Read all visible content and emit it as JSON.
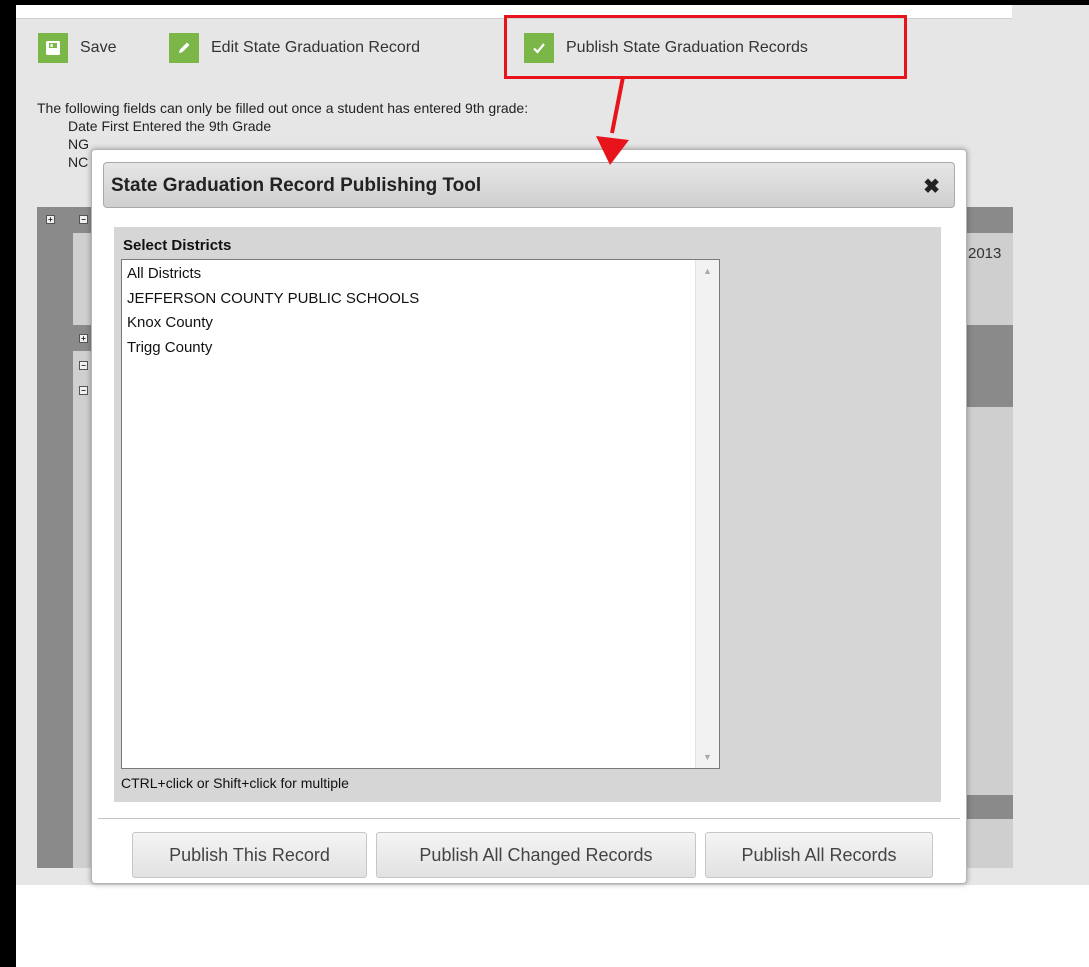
{
  "toolbar": {
    "save_label": "Save",
    "edit_label": "Edit State Graduation Record",
    "publish_label": "Publish State Graduation Records"
  },
  "notice": {
    "intro": "The following fields can only be filled out once a student has entered 9th grade:",
    "items": [
      "Date First Entered the 9th Grade",
      "NG",
      "NC"
    ]
  },
  "background": {
    "year_text": "2013"
  },
  "modal": {
    "title": "State Graduation Record Publishing Tool",
    "districts_label": "Select Districts",
    "districts": [
      "All Districts",
      "JEFFERSON COUNTY PUBLIC SCHOOLS",
      "Knox County",
      "Trigg County"
    ],
    "hint": "CTRL+click or Shift+click for multiple",
    "buttons": {
      "publish_this": "Publish This Record",
      "publish_changed": "Publish All Changed Records",
      "publish_all": "Publish All Records"
    }
  },
  "colors": {
    "accent_green": "#7ab648",
    "highlight_red": "#e8141b",
    "modal_header": "#d8d8d8"
  },
  "icons": {
    "save": "save-icon",
    "edit": "pencil-icon",
    "publish": "checkmark-icon",
    "close": "close-icon"
  }
}
